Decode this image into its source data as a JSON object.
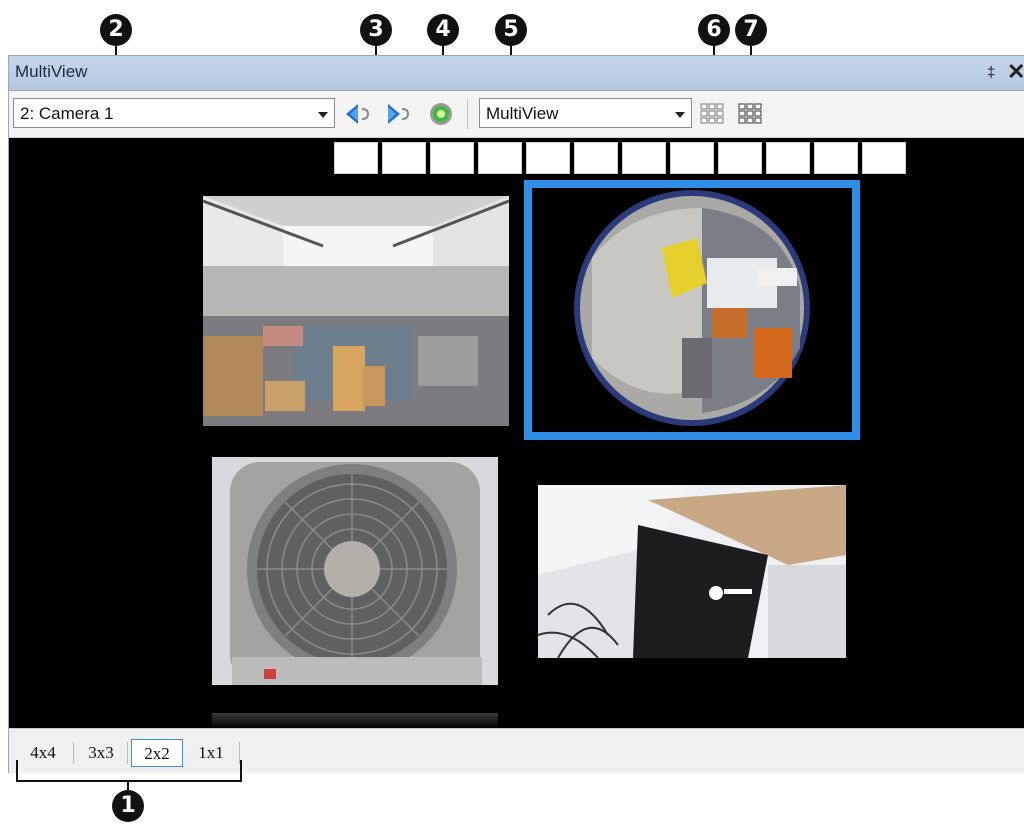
{
  "window": {
    "title": "MultiView",
    "pin_glyph": "‡",
    "close_glyph": "✕"
  },
  "toolbar": {
    "camera_select": {
      "value": "2: Camera 1"
    },
    "view_select": {
      "value": "MultiView"
    },
    "icons": [
      "previous-camera-icon",
      "next-camera-icon",
      "refresh-icon",
      "layout-grid-icon",
      "layout-grid-alt-icon"
    ]
  },
  "callouts": [
    "1",
    "2",
    "3",
    "4",
    "5",
    "6",
    "7"
  ],
  "viewport": {
    "slot_count": 12,
    "feeds": [
      "office-room-feed",
      "fisheye-camera-feed",
      "fan-closeup-feed",
      "device-closeup-feed"
    ],
    "selected_feed": "fisheye-camera-feed",
    "selected_color": "#2f8fe6"
  },
  "statusbar": {
    "layouts": [
      "4x4",
      "3x3",
      "2x2",
      "1x1"
    ],
    "active_layout": "2x2"
  }
}
